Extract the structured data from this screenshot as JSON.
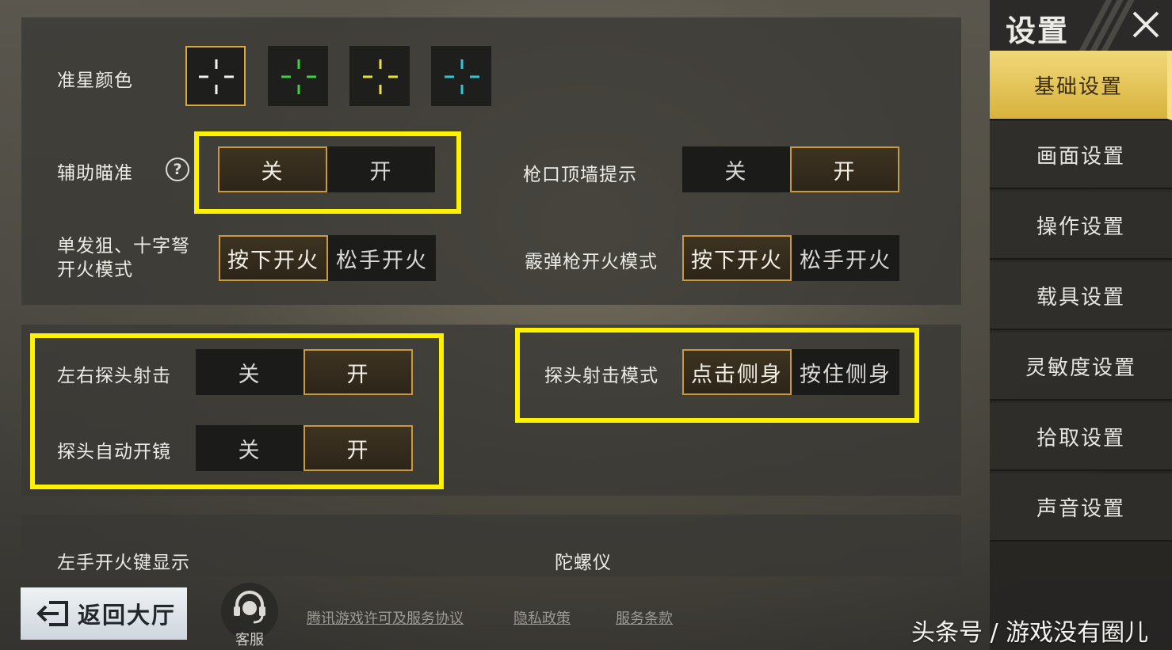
{
  "settings": {
    "crosshair_label": "准星颜色",
    "crosshair_colors": [
      "#f2f2f2",
      "#3fd13f",
      "#e8e33a",
      "#2fc6d6"
    ],
    "aim_assist": {
      "label": "辅助瞄准",
      "help": "?",
      "off": "关",
      "on": "开",
      "selected": "off"
    },
    "muzzle_wall": {
      "label": "枪口顶墙提示",
      "off": "关",
      "on": "开",
      "selected": "on"
    },
    "sniper_fire": {
      "label": "单发狙、十字弩\n开火模式",
      "press": "按下开火",
      "release": "松手开火",
      "selected": "press"
    },
    "shotgun_fire": {
      "label": "霰弹枪开火模式",
      "press": "按下开火",
      "release": "松手开火",
      "selected": "press"
    },
    "peek_fire": {
      "label": "左右探头射击",
      "off": "关",
      "on": "开",
      "selected": "on"
    },
    "peek_mode": {
      "label": "探头射击模式",
      "tap": "点击侧身",
      "hold": "按住侧身",
      "selected": "tap"
    },
    "peek_scope": {
      "label": "探头自动开镜",
      "off": "关",
      "on": "开",
      "selected": "on"
    },
    "left_fire_label": "左手开火键显示",
    "gyro_label": "陀螺仪"
  },
  "sidebar": {
    "title": "设置",
    "items": [
      "基础设置",
      "画面设置",
      "操作设置",
      "载具设置",
      "灵敏度设置",
      "拾取设置",
      "声音设置"
    ],
    "active_index": 0
  },
  "footer": {
    "back_label": "返回大厅",
    "service_label": "客服",
    "links": [
      "腾讯游戏许可及服务协议",
      "隐私政策",
      "服务条款"
    ]
  },
  "watermark": "头条号 / 游戏没有圈儿",
  "highlight_color": "#fff200"
}
